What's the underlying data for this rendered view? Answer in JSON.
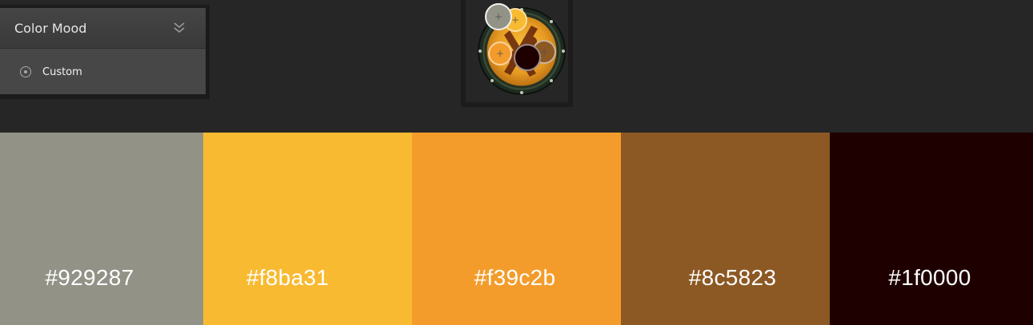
{
  "color_mood_panel": {
    "title": "Color Mood",
    "option_label": "Custom"
  },
  "source_image": {
    "pickers": [
      {
        "color": "#929287",
        "active": true
      },
      {
        "color": "#f8ba31",
        "active": false
      },
      {
        "color": "#f39c2b",
        "active": false
      },
      {
        "color": "#8c5823",
        "active": false
      },
      {
        "color": "#1f0000",
        "active": false
      }
    ]
  },
  "swatches": [
    {
      "hex": "#929287",
      "color": "#929287"
    },
    {
      "hex": "#f8ba31",
      "color": "#f8ba31"
    },
    {
      "hex": "#f39c2b",
      "color": "#f39c2b"
    },
    {
      "hex": "#8c5823",
      "color": "#8c5823"
    },
    {
      "hex": "#1f0000",
      "color": "#1f0000"
    }
  ]
}
